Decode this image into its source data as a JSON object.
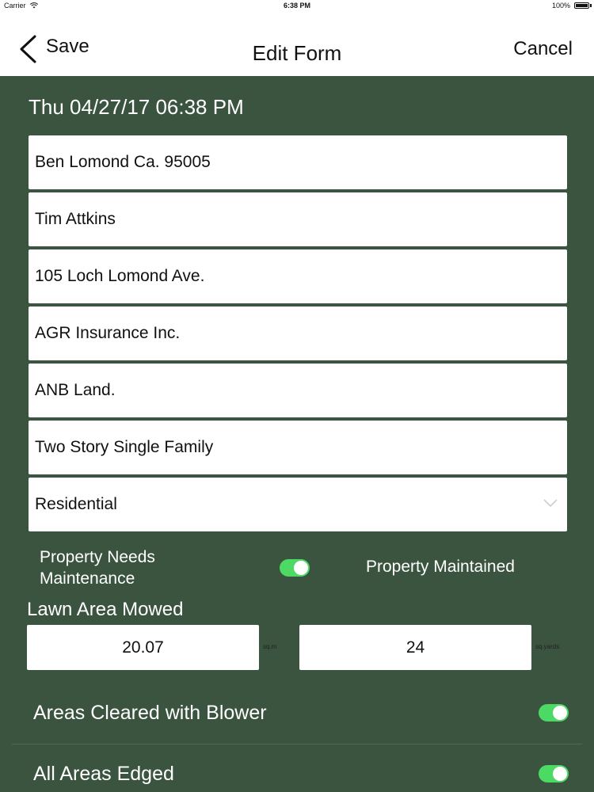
{
  "status_bar": {
    "carrier": "Carrier",
    "time": "6:38 PM",
    "battery": "100%",
    "icons": [
      "wifi-icon",
      "battery-icon"
    ]
  },
  "nav": {
    "back_label": "Save",
    "back_icon": "chevron-left-icon",
    "title": "Edit Form",
    "cancel_label": "Cancel"
  },
  "form": {
    "date": "Thu 04/27/17 06:38 PM",
    "fields": [
      "Ben Lomond Ca. 95005",
      "Tim Attkins",
      "105 Loch Lomond Ave.",
      "AGR Insurance Inc.",
      "ANB Land.",
      "Two Story Single Family"
    ],
    "property_type": {
      "selected": "Residential",
      "icon": "chevron-down-icon"
    },
    "maintenance_toggle": {
      "label_off": "Property Needs Maintenance",
      "label_on": "Property Maintained",
      "state": true
    },
    "lawn": {
      "title": "Lawn Area Mowed",
      "sq_m_value": "20.07",
      "sq_m_unit": "sq.m",
      "sq_yards_value": "24",
      "sq_yards_unit": "sq.yards"
    },
    "checks": [
      {
        "label": "Areas Cleared with Blower",
        "state": true
      },
      {
        "label": "All Areas Edged",
        "state": true
      }
    ]
  },
  "colors": {
    "background": "#3a5440",
    "toggle_on": "#4cd964",
    "field": "#ffffff"
  }
}
